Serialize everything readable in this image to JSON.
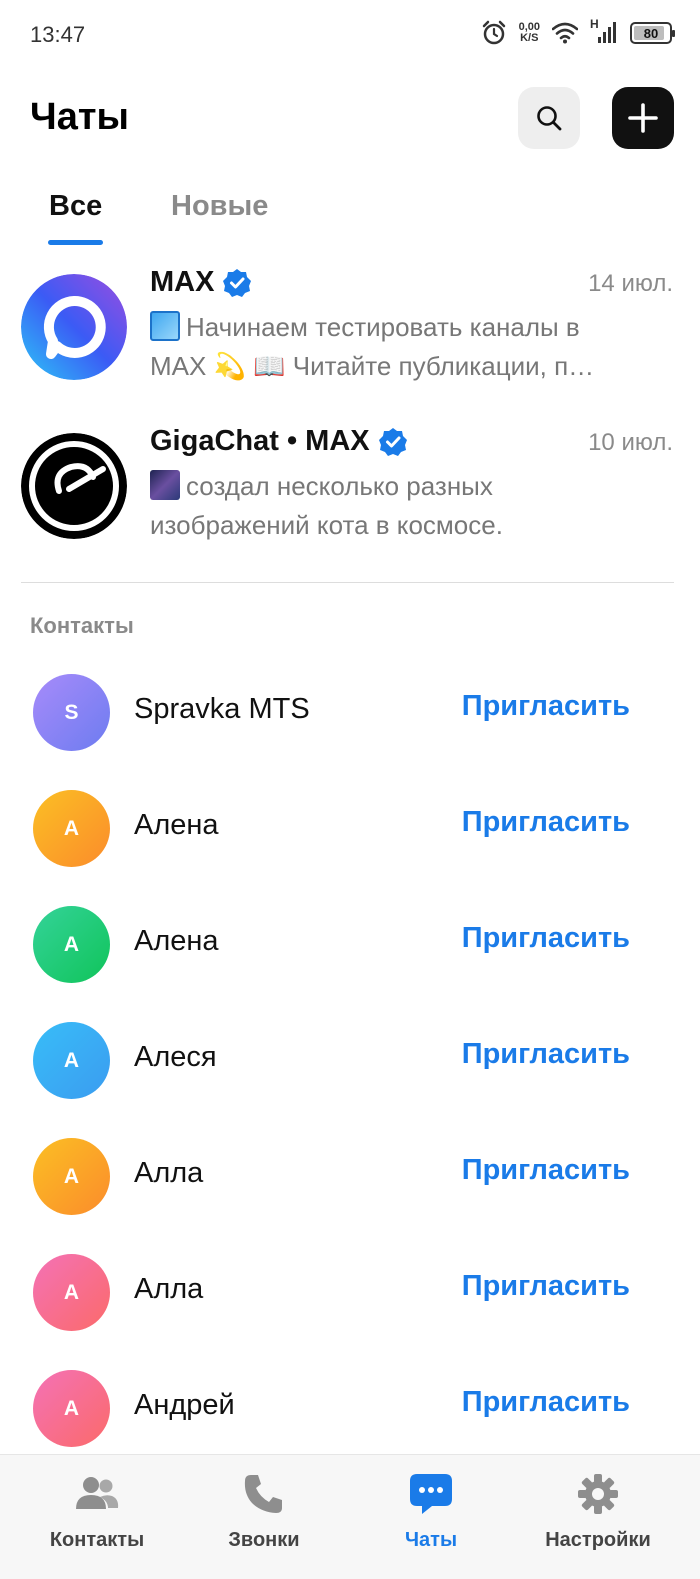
{
  "status_bar": {
    "time": "13:47",
    "net_speed_value": "0,00",
    "net_speed_unit": "K/S",
    "network_type": "H",
    "battery": "80",
    "icons": [
      "alarm-icon",
      "wifi-icon",
      "signal-icon",
      "battery-icon"
    ]
  },
  "header": {
    "title": "Чаты",
    "search_icon": "search-icon",
    "add_icon": "plus-icon"
  },
  "tabs": [
    {
      "label": "Все",
      "active": true
    },
    {
      "label": "Новые",
      "active": false
    }
  ],
  "chats": [
    {
      "name": "MAX",
      "verified": true,
      "date": "14 июл.",
      "preview_line1": "Начинаем тестировать каналы в",
      "preview_line2": "MAX 💫 📖 Читайте публикации, п…"
    },
    {
      "name": "GigaChat • MAX",
      "verified": true,
      "date": "10 июл.",
      "preview_line1": "создал несколько разных",
      "preview_line2": "изображений кота в космосе."
    }
  ],
  "contacts_section": {
    "label": "Контакты",
    "invite_label": "Пригласить",
    "items": [
      {
        "initial": "S",
        "name": "Spravka MTS",
        "color_from": "#a78bfa",
        "color_to": "#6d7cf0"
      },
      {
        "initial": "А",
        "name": "Алена",
        "color_from": "#fbbf24",
        "color_to": "#fb8c2b"
      },
      {
        "initial": "А",
        "name": "Алена",
        "color_from": "#34d399",
        "color_to": "#10c45a"
      },
      {
        "initial": "А",
        "name": "Алеся",
        "color_from": "#38bdf8",
        "color_to": "#3b9cf0"
      },
      {
        "initial": "А",
        "name": "Алла",
        "color_from": "#fbbf24",
        "color_to": "#fb8c2b"
      },
      {
        "initial": "А",
        "name": "Алла",
        "color_from": "#f472b6",
        "color_to": "#fb6a6a"
      },
      {
        "initial": "А",
        "name": "Андрей",
        "color_from": "#f472b6",
        "color_to": "#fb6a6a"
      }
    ]
  },
  "bottom_nav": [
    {
      "label": "Контакты",
      "icon": "contacts-icon",
      "active": false
    },
    {
      "label": "Звонки",
      "icon": "phone-icon",
      "active": false
    },
    {
      "label": "Чаты",
      "icon": "chat-bubble-icon",
      "active": true
    },
    {
      "label": "Настройки",
      "icon": "gear-icon",
      "active": false
    }
  ],
  "colors": {
    "accent": "#1a7be8",
    "verified": "#1a7be8",
    "muted_text": "#8a8a8a"
  }
}
